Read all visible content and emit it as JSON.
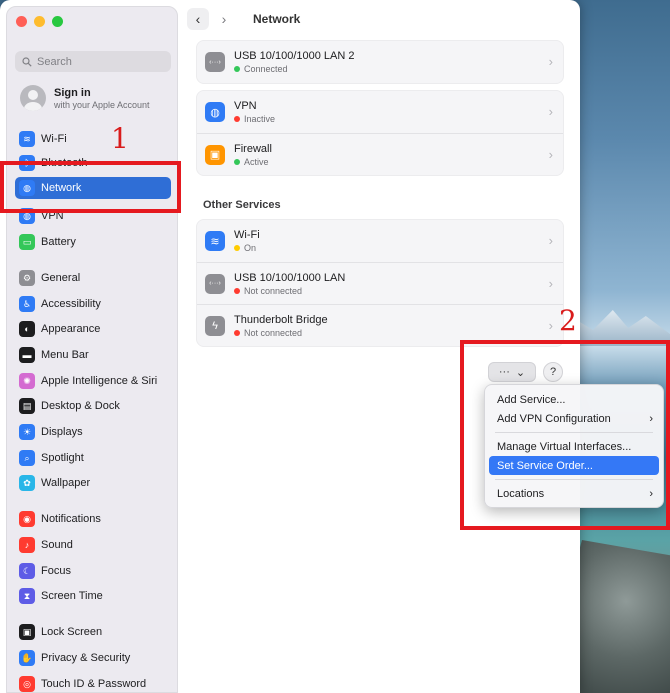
{
  "window": {
    "title": "Network"
  },
  "sidebar": {
    "search_placeholder": "Search",
    "account": {
      "title": "Sign in",
      "subtitle": "with your Apple Account"
    },
    "items": [
      {
        "label": "Wi-Fi",
        "icon": "wifi-icon",
        "color": "#2f7bf5"
      },
      {
        "label": "Bluetooth",
        "icon": "bluetooth-icon",
        "color": "#2f7bf5"
      },
      {
        "label": "Network",
        "icon": "globe-icon",
        "color": "#2f7bf5",
        "selected": true
      },
      {
        "label": "VPN",
        "icon": "vpn-icon",
        "color": "#2f7bf5"
      },
      {
        "label": "Battery",
        "icon": "battery-icon",
        "color": "#34c759"
      },
      {
        "label": "General",
        "icon": "gear-icon",
        "color": "#8e8e93"
      },
      {
        "label": "Accessibility",
        "icon": "accessibility-icon",
        "color": "#2f7bf5"
      },
      {
        "label": "Appearance",
        "icon": "appearance-icon",
        "color": "#1d1d1f"
      },
      {
        "label": "Menu Bar",
        "icon": "menubar-icon",
        "color": "#1d1d1f"
      },
      {
        "label": "Apple Intelligence & Siri",
        "icon": "siri-icon",
        "color": "#d46bd1"
      },
      {
        "label": "Desktop & Dock",
        "icon": "dock-icon",
        "color": "#1d1d1f"
      },
      {
        "label": "Displays",
        "icon": "displays-icon",
        "color": "#2f7bf5"
      },
      {
        "label": "Spotlight",
        "icon": "spotlight-icon",
        "color": "#2f7bf5"
      },
      {
        "label": "Wallpaper",
        "icon": "wallpaper-icon",
        "color": "#29b6e8"
      },
      {
        "label": "Notifications",
        "icon": "notifications-icon",
        "color": "#ff3b30"
      },
      {
        "label": "Sound",
        "icon": "sound-icon",
        "color": "#ff3b30"
      },
      {
        "label": "Focus",
        "icon": "focus-icon",
        "color": "#5e5ce6"
      },
      {
        "label": "Screen Time",
        "icon": "screentime-icon",
        "color": "#5e5ce6"
      },
      {
        "label": "Lock Screen",
        "icon": "lock-icon",
        "color": "#1d1d1f"
      },
      {
        "label": "Privacy & Security",
        "icon": "privacy-icon",
        "color": "#2f7bf5"
      },
      {
        "label": "Touch ID & Password",
        "icon": "touchid-icon",
        "color": "#ff3b30"
      }
    ]
  },
  "services": [
    {
      "name": "USB 10/100/1000 LAN 2",
      "status": "Connected",
      "status_color": "#34c759",
      "icon": "ethernet-icon",
      "icon_color": "#8e8e93"
    }
  ],
  "vpn_firewall": [
    {
      "name": "VPN",
      "status": "Inactive",
      "status_color": "#ff3b30",
      "icon": "vpn-globe-icon",
      "icon_color": "#2f7bf5"
    },
    {
      "name": "Firewall",
      "status": "Active",
      "status_color": "#34c759",
      "icon": "firewall-icon",
      "icon_color": "#ff9500"
    }
  ],
  "other_services": {
    "title": "Other Services",
    "items": [
      {
        "name": "Wi-Fi",
        "status": "On",
        "status_color": "#ffcc00",
        "icon": "wifi-icon",
        "icon_color": "#2f7bf5"
      },
      {
        "name": "USB 10/100/1000 LAN",
        "status": "Not connected",
        "status_color": "#ff3b30",
        "icon": "ethernet-icon",
        "icon_color": "#8e8e93"
      },
      {
        "name": "Thunderbolt Bridge",
        "status": "Not connected",
        "status_color": "#ff3b30",
        "icon": "thunderbolt-icon",
        "icon_color": "#8e8e93"
      }
    ]
  },
  "actions": {
    "more_label": "···",
    "help_label": "?"
  },
  "menu": {
    "items": [
      {
        "label": "Add Service...",
        "submenu": false
      },
      {
        "label": "Add VPN Configuration",
        "submenu": true
      },
      {
        "separator": true
      },
      {
        "label": "Manage Virtual Interfaces...",
        "submenu": false
      },
      {
        "label": "Set Service Order...",
        "submenu": false,
        "highlighted": true
      },
      {
        "separator": true
      },
      {
        "label": "Locations",
        "submenu": true
      }
    ]
  },
  "annotations": {
    "one": "1",
    "two": "2",
    "color": "#e5191f"
  }
}
